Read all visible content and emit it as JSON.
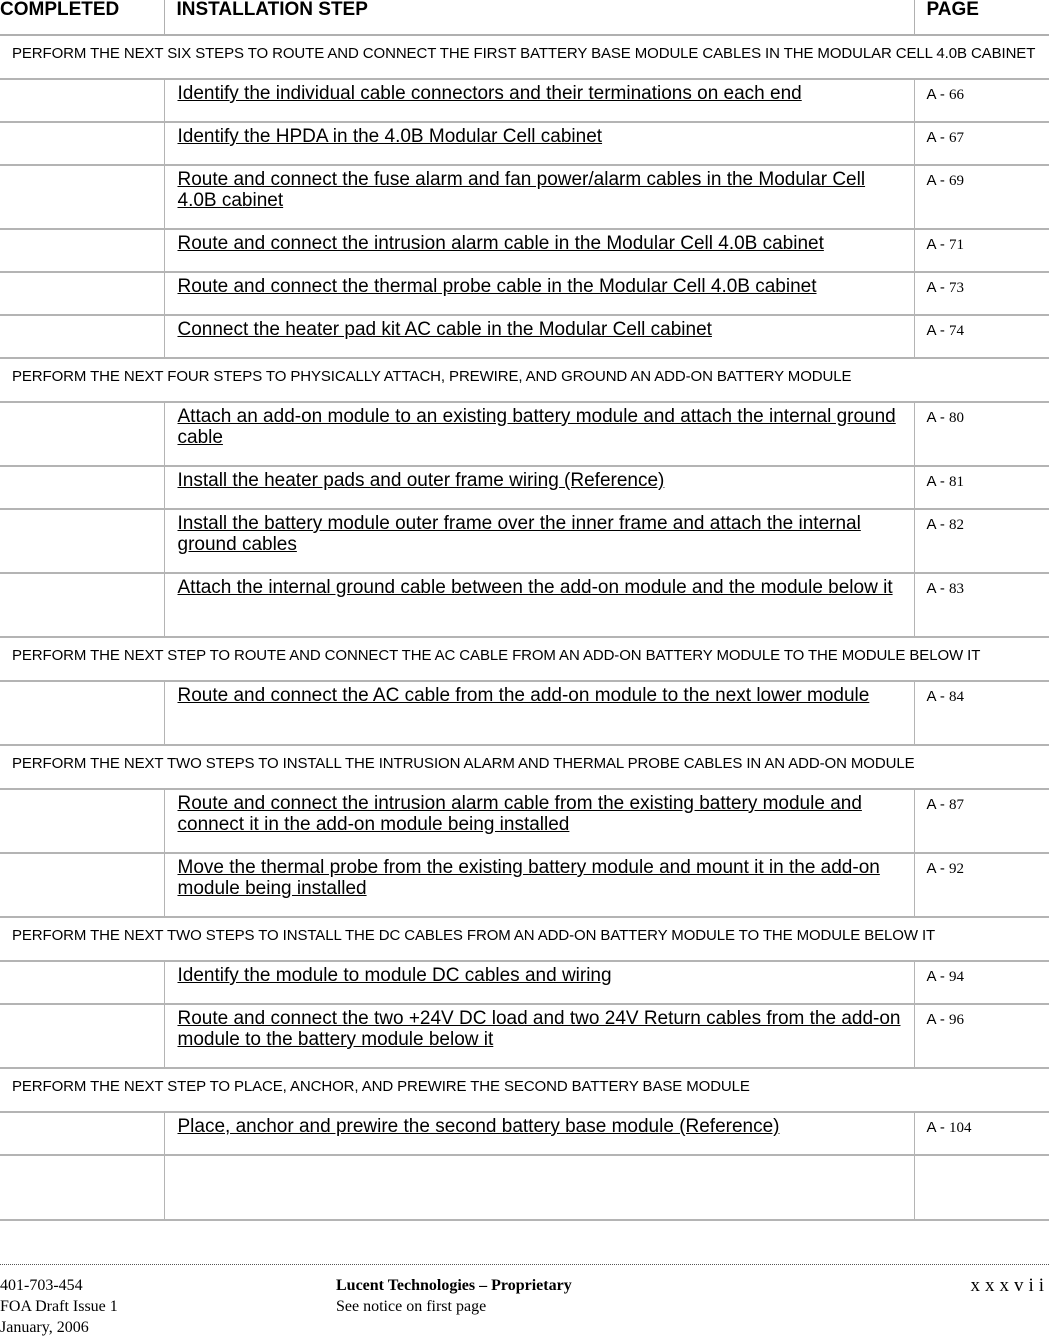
{
  "table": {
    "headers": {
      "completed": "COMPLETED",
      "step": "INSTALLATION STEP",
      "page": "PAGE"
    },
    "sections": [
      {
        "title": "PERFORM THE NEXT SIX STEPS TO ROUTE AND CONNECT THE FIRST BATTERY BASE MODULE CABLES IN THE MODULAR CELL 4.0B CABINET",
        "steps": [
          {
            "text": "Identify the individual cable connectors and their terminations on each end",
            "page_prefix": "A - ",
            "page_num": "66"
          },
          {
            "text": "Identify the HPDA in the 4.0B Modular Cell cabinet",
            "page_prefix": "A - ",
            "page_num": "67"
          },
          {
            "text": "Route and connect the fuse alarm and fan power/alarm cables in the Modular Cell 4.0B cabinet",
            "page_prefix": "A - ",
            "page_num": "69"
          },
          {
            "text": "Route and connect the intrusion alarm cable in the Modular Cell 4.0B cabinet",
            "page_prefix": "A - ",
            "page_num": "71"
          },
          {
            "text": "Route and connect the thermal probe cable in the Modular Cell 4.0B cabinet",
            "page_prefix": "A - ",
            "page_num": "73"
          },
          {
            "text": "Connect the heater pad kit AC cable in the Modular Cell cabinet",
            "page_prefix": "A - ",
            "page_num": "74"
          }
        ]
      },
      {
        "title": "PERFORM THE NEXT FOUR STEPS TO PHYSICALLY ATTACH, PREWIRE, AND GROUND AN ADD-ON BATTERY MODULE",
        "steps": [
          {
            "text": "Attach an add-on module to an existing battery module and attach the internal ground cable",
            "page_prefix": "A - ",
            "page_num": "80"
          },
          {
            "text": "Install the heater pads and outer frame wiring (Reference)",
            "page_prefix": "A - ",
            "page_num": "81"
          },
          {
            "text": "Install the battery module outer frame over the inner frame and attach the internal ground cables",
            "page_prefix": "A - ",
            "page_num": "82"
          },
          {
            "text": "Attach the internal ground cable between the add-on module and the module below it",
            "page_prefix": "A - ",
            "page_num": "83"
          }
        ]
      },
      {
        "title": "PERFORM THE NEXT STEP TO ROUTE AND CONNECT THE AC CABLE FROM AN ADD-ON BATTERY MODULE TO THE MODULE BELOW IT",
        "steps": [
          {
            "text": "Route and connect the AC cable from the add-on module to the next lower module",
            "page_prefix": "A - ",
            "page_num": "84"
          }
        ]
      },
      {
        "title": "PERFORM THE NEXT TWO STEPS TO INSTALL THE INTRUSION ALARM AND THERMAL PROBE CABLES IN AN ADD-ON MODULE",
        "steps": [
          {
            "text": "Route and connect the intrusion alarm cable from the existing battery module and connect it in the add-on module being installed",
            "page_prefix": "A - ",
            "page_num": "87"
          },
          {
            "text": "Move the thermal probe from the existing battery module and mount it in the add-on module being installed",
            "page_prefix": "A - ",
            "page_num": "92"
          }
        ]
      },
      {
        "title": "PERFORM THE NEXT TWO STEPS TO INSTALL THE DC CABLES FROM AN ADD-ON BATTERY MODULE TO THE MODULE BELOW IT",
        "steps": [
          {
            "text": "Identify the module to module DC cables and wiring",
            "page_prefix": "A - ",
            "page_num": "94"
          },
          {
            "text": "Route and connect the two +24V DC load and two 24V Return cables from the add-on module to the battery module below it",
            "page_prefix": "A - ",
            "page_num": "96"
          }
        ]
      },
      {
        "title": "PERFORM THE NEXT STEP TO PLACE, ANCHOR, AND PREWIRE THE SECOND BATTERY BASE MODULE",
        "steps": [
          {
            "text": "Place, anchor and prewire the second battery base module (Reference)",
            "page_prefix": "A - ",
            "page_num": "104"
          }
        ]
      }
    ]
  },
  "footer": {
    "doc_number": "401-703-454",
    "issue": "FOA Draft Issue 1",
    "date": "January, 2006",
    "company": "Lucent Technologies – Proprietary",
    "notice": "See notice on first page",
    "page_number": "xxxvii"
  }
}
